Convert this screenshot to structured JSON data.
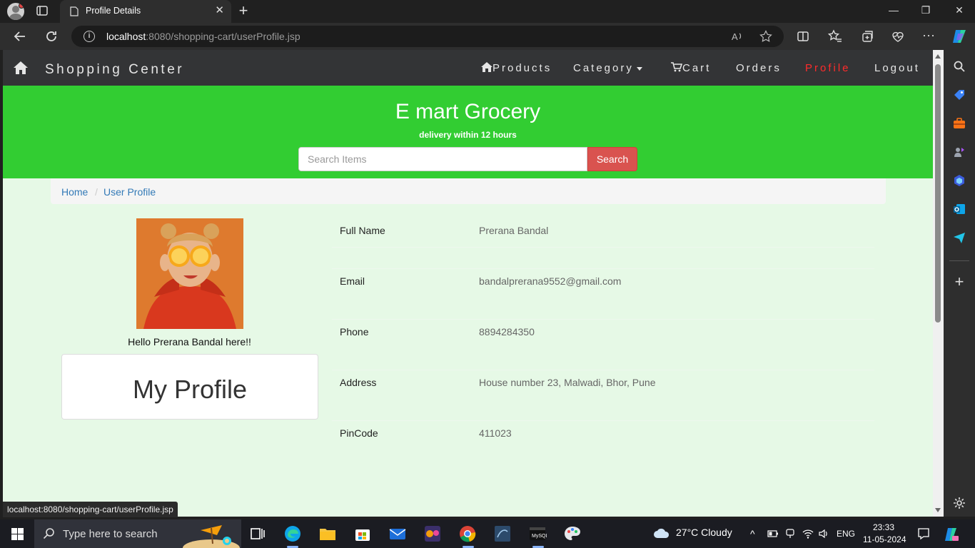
{
  "browser": {
    "tab_title": "Profile Details",
    "url_host": "localhost",
    "url_rest": ":8080/shopping-cart/userProfile.jsp",
    "status_url": "localhost:8080/shopping-cart/userProfile.jsp",
    "accent": "#32cd32"
  },
  "navbar": {
    "brand": "Shopping Center",
    "products": "Products",
    "category": "Category",
    "cart": "Cart",
    "orders": "Orders",
    "profile": "Profile",
    "logout": "Logout",
    "active_color": "#ff2b2b"
  },
  "banner": {
    "title": "E mart Grocery",
    "subtitle": "delivery within 12 hours",
    "search_placeholder": "Search Items",
    "search_button": "Search"
  },
  "breadcrumb": {
    "home": "Home",
    "separator": "/",
    "current": "User Profile"
  },
  "profile": {
    "greeting": "Hello Prerana Bandal here!!",
    "card_title": "My Profile",
    "rows": [
      {
        "label": "Full Name",
        "value": "Prerana Bandal"
      },
      {
        "label": "Email",
        "value": "bandalprerana9552@gmail.com"
      },
      {
        "label": "Phone",
        "value": "8894284350"
      },
      {
        "label": "Address",
        "value": "House number 23, Malwadi, Bhor, Pune"
      },
      {
        "label": "PinCode",
        "value": "411023"
      }
    ]
  },
  "taskbar": {
    "search_placeholder": "Type here to search",
    "weather": "27°C  Cloudy",
    "language": "ENG",
    "time": "23:33",
    "date": "11-05-2024"
  }
}
